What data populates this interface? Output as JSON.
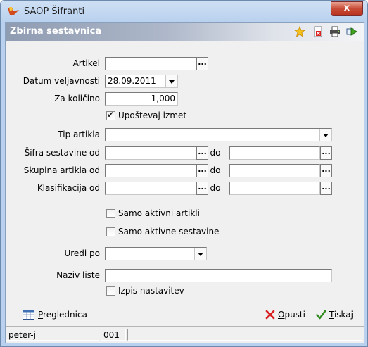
{
  "window": {
    "title": "SAOP Šifranti",
    "close_symbol": "x"
  },
  "header": {
    "title": "Zbirna sestavnica"
  },
  "header_icons": [
    "star-icon",
    "delete-document-icon",
    "printer-icon",
    "run-icon"
  ],
  "form": {
    "artikel": {
      "label": "Artikel",
      "value": ""
    },
    "datum": {
      "label": "Datum veljavnosti",
      "value": "28.09.2011"
    },
    "kolicina": {
      "label": "Za količino",
      "value": "1,000"
    },
    "izmet": {
      "label": "Upoštevaj izmet",
      "checked": true
    },
    "tip": {
      "label": "Tip artikla",
      "value": ""
    },
    "sifra": {
      "label": "Šifra sestavine od",
      "from": "",
      "to": ""
    },
    "skupina": {
      "label": "Skupina artikla od",
      "from": "",
      "to": ""
    },
    "klasifikacija": {
      "label": "Klasifikacija od",
      "from": "",
      "to": ""
    },
    "do_label": "do",
    "ellipsis": "...",
    "samo_aktivni": {
      "label": "Samo aktivni artikli",
      "checked": false
    },
    "samo_aktivne": {
      "label": "Samo aktivne sestavine",
      "checked": false
    },
    "uredi": {
      "label": "Uredi po",
      "value": ""
    },
    "naziv": {
      "label": "Naziv liste",
      "value": ""
    },
    "nastavitev": {
      "label": "Izpis nastavitev",
      "checked": false
    }
  },
  "buttons": {
    "preglednica": {
      "mnemonic": "P",
      "rest": "reglednica"
    },
    "opusti": {
      "mnemonic": "O",
      "rest": "pusti"
    },
    "tiskaj": {
      "mnemonic": "T",
      "rest": "iskaj"
    }
  },
  "status": {
    "user": "peter-j",
    "code": "001"
  },
  "colors": {
    "header_bg": "#8f9bb1",
    "close_red": "#c74a35",
    "accent_green": "#2f8a1e"
  }
}
